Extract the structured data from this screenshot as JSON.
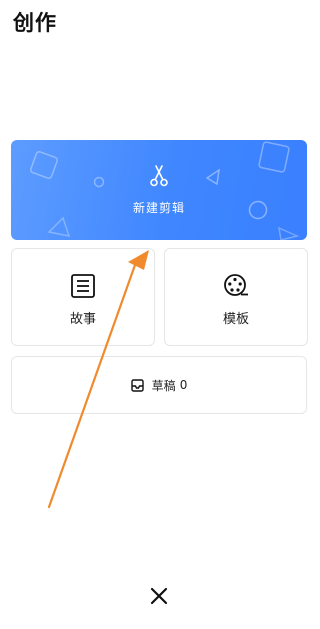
{
  "header": {
    "title": "创作"
  },
  "new_edit": {
    "label": "新建剪辑",
    "icon": "scissors-icon",
    "gradient_start": "#5d9cff",
    "gradient_end": "#3a80ff"
  },
  "tiles": [
    {
      "label": "故事",
      "icon": "article-icon"
    },
    {
      "label": "模板",
      "icon": "film-reel-icon"
    }
  ],
  "drafts": {
    "label": "草稿",
    "count": "0",
    "icon": "inbox-icon"
  },
  "annotation": {
    "arrow_color": "#f08a2c"
  },
  "bottom_bar": {
    "close_icon": "close-icon"
  }
}
